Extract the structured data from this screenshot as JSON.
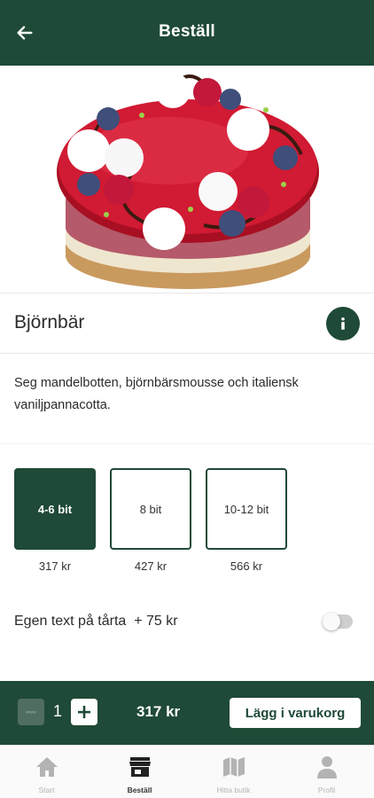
{
  "header": {
    "title": "Beställ"
  },
  "product": {
    "name": "Björnbär",
    "description": "Seg mandelbotten, björnbärsmousse och italiensk vaniljpannacotta."
  },
  "sizes": [
    {
      "label": "4-6 bit",
      "price": "317 kr",
      "selected": true
    },
    {
      "label": "8 bit",
      "price": "427 kr",
      "selected": false
    },
    {
      "label": "10-12 bit",
      "price": "566 kr",
      "selected": false
    }
  ],
  "custom_text": {
    "label": "Egen text på tårta  + 75 kr",
    "enabled": false
  },
  "cart": {
    "quantity": "1",
    "total": "317 kr",
    "add_label": "Lägg i varukorg"
  },
  "tabs": [
    {
      "label": "Start",
      "icon": "home-icon",
      "active": false
    },
    {
      "label": "Beställ",
      "icon": "store-icon",
      "active": true
    },
    {
      "label": "Hitta butik",
      "icon": "map-icon",
      "active": false
    },
    {
      "label": "Profil",
      "icon": "person-icon",
      "active": false
    }
  ],
  "colors": {
    "brand_green": "#1f4a37",
    "cake_red": "#c8102e"
  }
}
